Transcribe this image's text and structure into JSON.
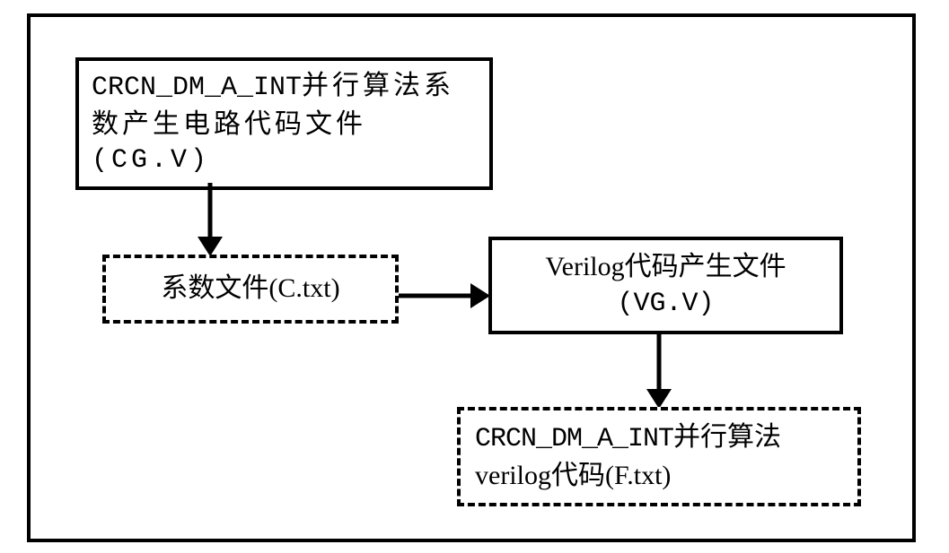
{
  "diagram": {
    "box1": {
      "line1_code": "CRCN_DM_A_INT",
      "line1_zh": "并行算法系",
      "line2": "数产生电路代码文件",
      "line3": "(CG.V)"
    },
    "box2": {
      "text": "系数文件(C.txt)"
    },
    "box3": {
      "line1": "Verilog代码产生文件",
      "line2": "(VG.V)"
    },
    "box4": {
      "line1_code": "CRCN_DM_A_INT",
      "line1_zh": "并行算法",
      "line2": "verilog代码(F.txt)"
    }
  }
}
